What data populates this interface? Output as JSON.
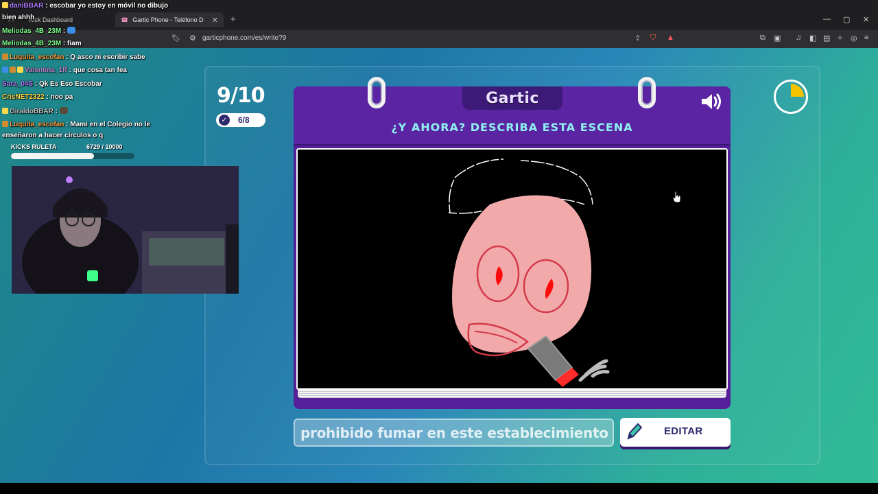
{
  "browser": {
    "tabs": [
      {
        "label": "Kick Dashboard",
        "active": false
      },
      {
        "label": "Gartic Phone - Teléfono Desc",
        "active": true
      }
    ],
    "new_tab": "+",
    "url": "garticphone.com/es/write?9",
    "window_controls": [
      "—",
      "▢",
      "✕"
    ]
  },
  "chat": [
    {
      "user": "daniBBAR",
      "text": "escobar yo estoy en móvil no dibujo",
      "color": "purple"
    },
    {
      "user": "",
      "text": "bien ahhh",
      "color": ""
    },
    {
      "user": "Meliodas_4B_23M",
      "text": "",
      "color": "green",
      "emote": true
    },
    {
      "user": "Meliodas_4B_23M",
      "text": "fiam",
      "color": "green"
    },
    {
      "user": "Luquita_escofan",
      "text": "Q asco ni escribir sabe",
      "color": "orange"
    },
    {
      "user": "Valentina_1ff",
      "text": "que cosa tan fea",
      "color": "pink"
    },
    {
      "user": "Sara_04S",
      "text": "Qk Es Eso Escobar",
      "color": "purple"
    },
    {
      "user": "CrisNET2322",
      "text": "noo pa",
      "color": "yellow"
    },
    {
      "user": "GiraldoBBAR",
      "text": "",
      "color": "blue",
      "emote": true
    },
    {
      "user": "Luquita_escofan",
      "text": "Mami en el Colegio no le",
      "color": "orange"
    },
    {
      "user": "",
      "text": "enseñaron a hacer círculos o q",
      "color": ""
    }
  ],
  "ruleta": {
    "label": "KICKS RULETA",
    "count": "6729  / 10000",
    "progress": 0.6729
  },
  "game": {
    "round": "9/10",
    "submitted": "6/8",
    "logo": "Gartic",
    "prompt": "¿Y AHORA? DESCRIBA ESTA ESCENA",
    "answer": "prohibido fumar en este establecimiento",
    "edit_label": "EDITAR",
    "timer_fraction": 0.25
  },
  "colors": {
    "card": "#541f98",
    "prompt": "#8ff0f0",
    "accent": "#2d2a6e"
  }
}
